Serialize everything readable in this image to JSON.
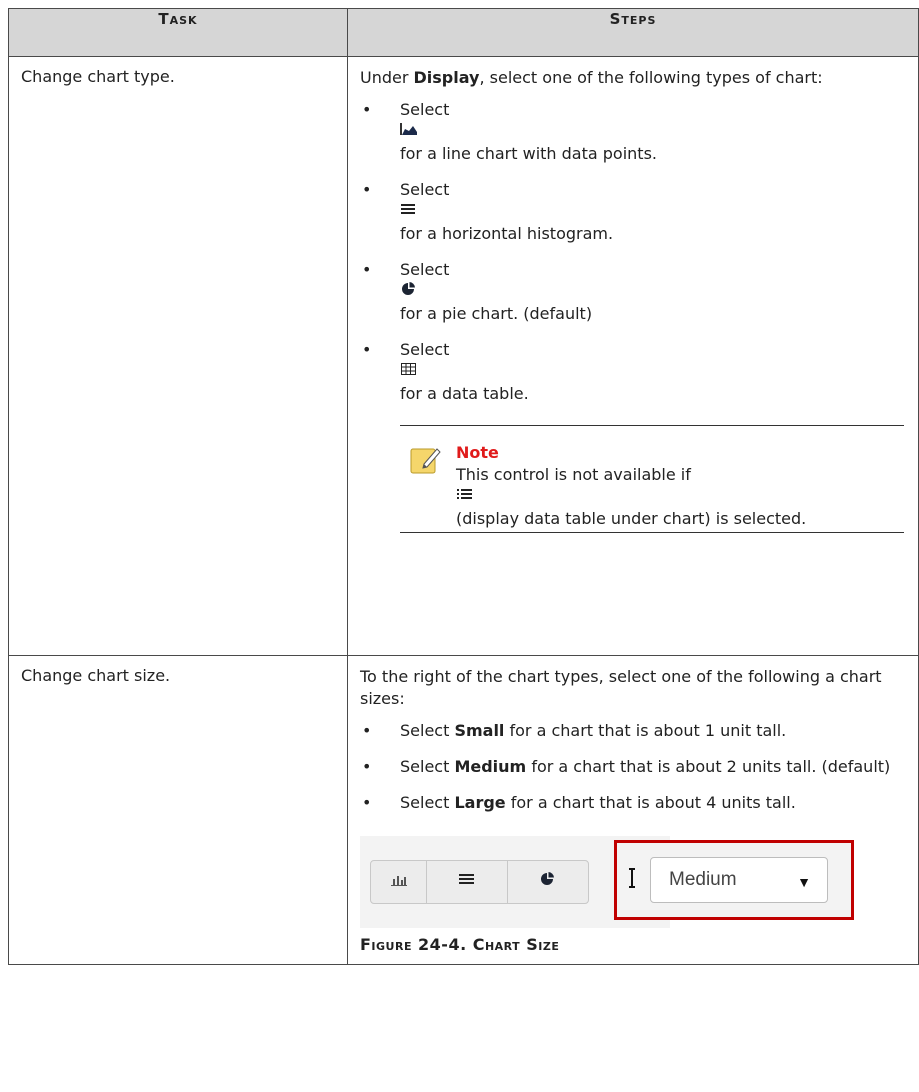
{
  "headers": {
    "task": "Task",
    "steps": "Steps"
  },
  "row1": {
    "task": "Change chart type.",
    "intro_pre": "Under ",
    "intro_bold": "Display",
    "intro_post": ", select one of the following types of chart:",
    "bullets": [
      {
        "select": "Select",
        "icon": "area-chart-icon",
        "desc": "for a line chart with data points."
      },
      {
        "select": "Select",
        "icon": "list-lines-icon",
        "desc": "for a horizontal histogram."
      },
      {
        "select": "Select",
        "icon": "pie-chart-icon",
        "desc": "for a pie chart. (default)"
      },
      {
        "select": "Select",
        "icon": "grid-table-icon",
        "desc": "for a data table."
      }
    ],
    "note": {
      "title": "Note",
      "line1": "This control is not available if",
      "icon": "list-bullets-icon",
      "line2": "(display data table under chart) is selected."
    }
  },
  "row2": {
    "task": "Change chart size.",
    "intro": "To the right of the chart types, select one of the following a chart sizes:",
    "bullets": [
      {
        "pre": "Select ",
        "bold": "Small",
        "post": " for a chart that is about 1 unit tall."
      },
      {
        "pre": "Select ",
        "bold": "Medium",
        "post": " for a chart that is about 2 units tall. (default)"
      },
      {
        "pre": "Select ",
        "bold": "Large",
        "post": " for a chart that is about 4 units tall."
      }
    ],
    "figure": {
      "select_value": "Medium",
      "caption": "Figure 24-4. Chart Size"
    }
  },
  "bullet_char": "•"
}
